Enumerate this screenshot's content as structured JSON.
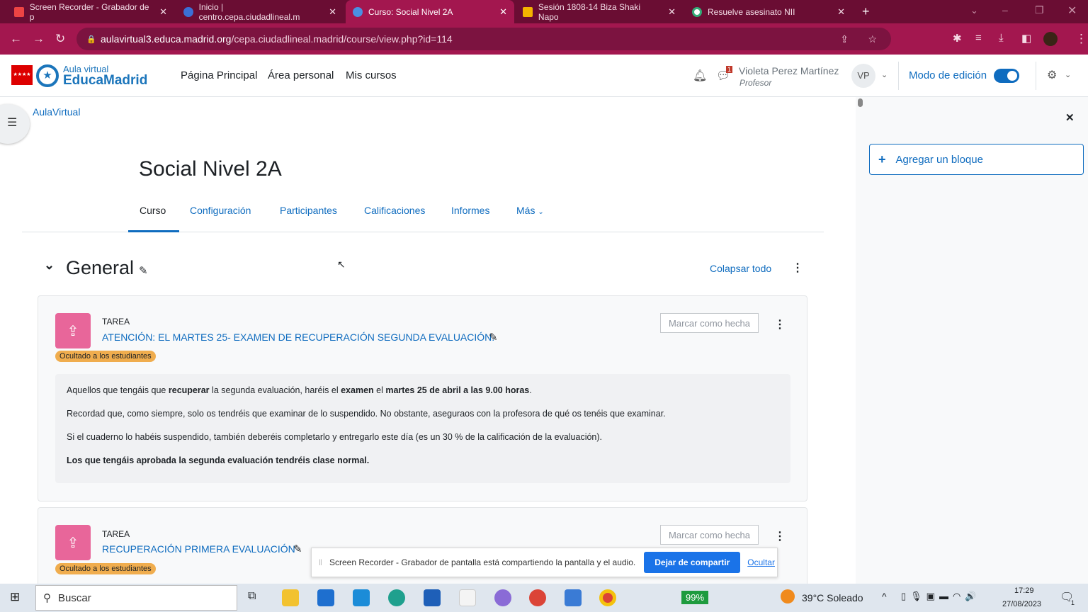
{
  "browser": {
    "tabs": [
      {
        "title": "Screen Recorder - Grabador de p",
        "active": false
      },
      {
        "title": "Inicio | centro.cepa.ciudadlineal.m",
        "active": false
      },
      {
        "title": "Curso: Social Nivel 2A",
        "active": true
      },
      {
        "title": "Sesión 1808-14 Biza Shaki Napo",
        "active": false
      },
      {
        "title": "Resuelve asesinato NII",
        "active": false
      }
    ],
    "url_host": "aulavirtual3.educa.madrid.org",
    "url_path": "/cepa.ciudadlineal.madrid/course/view.php?id=114"
  },
  "site": {
    "logo_top": "Aula virtual",
    "logo_bottom": "EducaMadrid",
    "nav": [
      "Página Principal",
      "Área personal",
      "Mis cursos"
    ],
    "notification_count": "1",
    "user_name": "Violeta Perez Martínez",
    "user_role": "Profesor",
    "avatar": "VP",
    "edit_mode_label": "Modo de edición",
    "edit_mode_on": true
  },
  "breadcrumb": "AulaVirtual",
  "course": {
    "title": "Social Nivel 2A",
    "tabs": [
      "Curso",
      "Configuración",
      "Participantes",
      "Calificaciones",
      "Informes",
      "Más"
    ],
    "active_tab": "Curso"
  },
  "section": {
    "title": "General",
    "collapse_all": "Colapsar todo"
  },
  "activities": [
    {
      "type": "TAREA",
      "name": "ATENCIÓN: EL MARTES 25- EXAMEN DE RECUPERACIÓN SEGUNDA EVALUACIÓN.",
      "badge": "Ocultado a los estudiantes",
      "mark": "Marcar como hecha",
      "desc": [
        "Aquellos que tengáis que recuperar la segunda evaluación, haréis el examen el martes 25 de abril a las 9.00 horas.",
        "Recordad que, como siempre, solo os tendréis que examinar de lo suspendido. No obstante, aseguraos con la profesora de qué os tenéis que examinar.",
        "Si el cuaderno lo habéis suspendido, también deberéis completarlo y entregarlo este día (es un 30 % de la calificación de la evaluación).",
        "Los que tengáis aprobada la segunda evaluación tendréis clase normal."
      ]
    },
    {
      "type": "TAREA",
      "name": "RECUPERACIÓN PRIMERA EVALUACIÓN",
      "badge": "Ocultado a los estudiantes",
      "mark": "Marcar como hecha"
    }
  ],
  "drawer": {
    "add_block": "Agregar un bloque"
  },
  "share_bar": {
    "text": "Screen Recorder - Grabador de pantalla está compartiendo la pantalla y el audio.",
    "stop": "Dejar de compartir",
    "hide": "Ocultar"
  },
  "taskbar": {
    "search": "Buscar",
    "battery": "99%",
    "weather": "39°C  Soleado",
    "time": "17:29",
    "date": "27/08/2023",
    "notif": "1"
  }
}
